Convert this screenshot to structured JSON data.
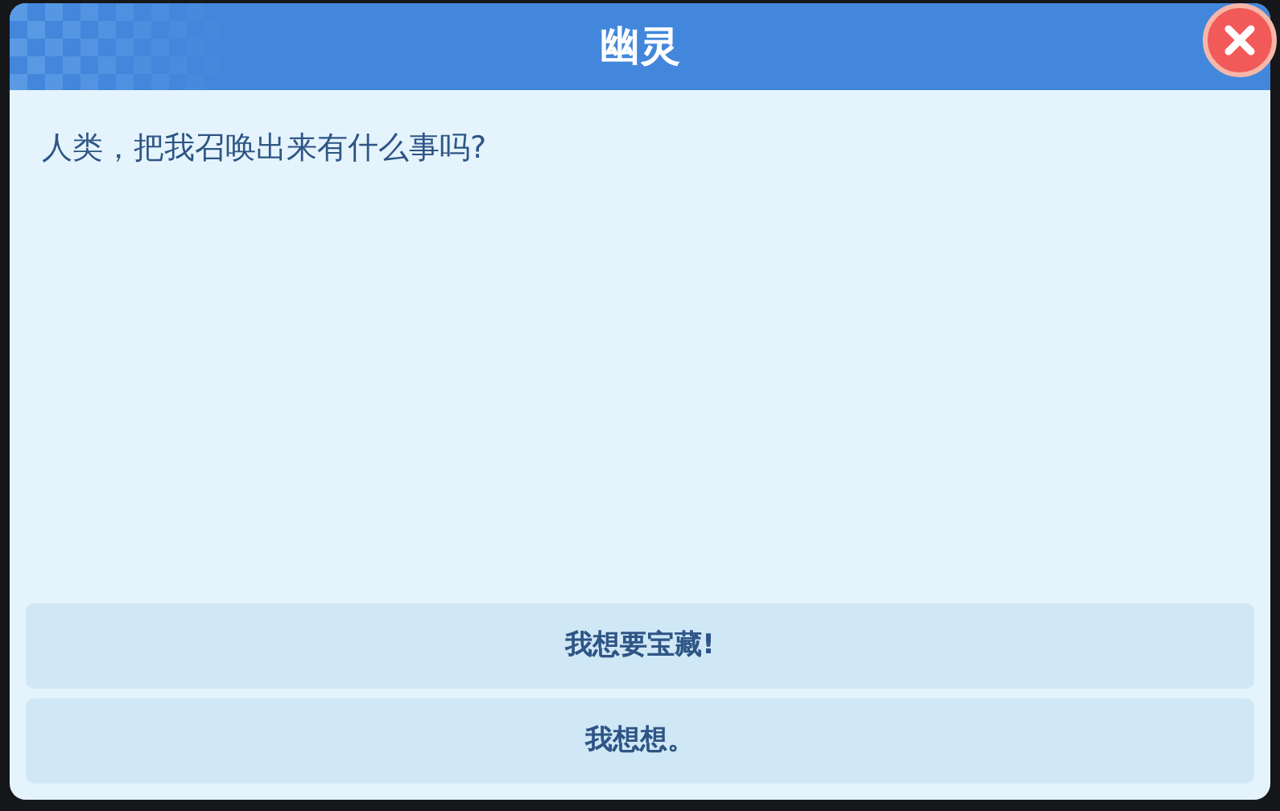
{
  "dialog": {
    "title": "幽灵",
    "message": "人类，把我召唤出来有什么事吗?",
    "options": [
      "我想要宝藏!",
      "我想想。"
    ]
  }
}
